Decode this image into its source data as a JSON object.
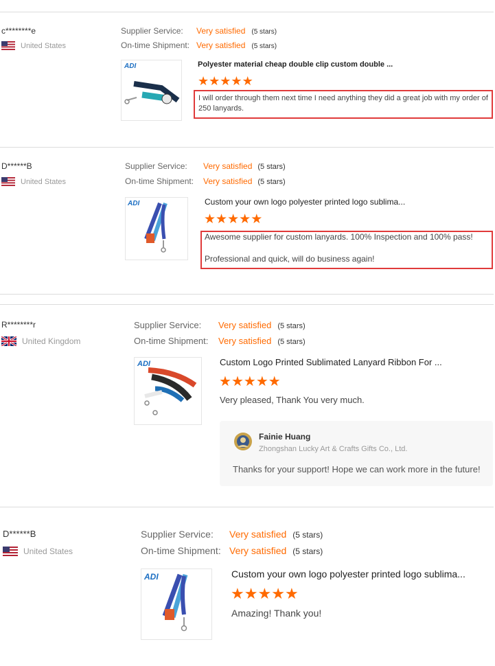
{
  "labels": {
    "supplier_service": "Supplier Service:",
    "on_time_shipment": "On-time Shipment:"
  },
  "colors": {
    "accent": "#ff6a00",
    "highlight_box": "#e03a3a"
  },
  "reviews": [
    {
      "buyer": "c********e",
      "country": "United States",
      "flag_icon": "us-flag-icon",
      "supplier_service": {
        "value": "Very satisfied",
        "stars": "(5 stars)"
      },
      "on_time_shipment": {
        "value": "Very satisfied",
        "stars": "(5 stars)"
      },
      "product_title": "Polyester material cheap double clip custom double ...",
      "thumb_logo": "ADI",
      "rating": 5,
      "comment": "I will order through them next time I need anything they did a great job with my order of 250 lanyards."
    },
    {
      "buyer": "D******B",
      "country": "United States",
      "flag_icon": "us-flag-icon",
      "supplier_service": {
        "value": "Very satisfied",
        "stars": "(5 stars)"
      },
      "on_time_shipment": {
        "value": "Very satisfied",
        "stars": "(5 stars)"
      },
      "product_title": "Custom your own logo polyester printed logo sublima...",
      "thumb_logo": "ADI",
      "rating": 5,
      "comment_line1": "Awesome supplier for custom lanyards. 100% Inspection and 100% pass!",
      "comment_line2": "Professional and quick, will do business again!"
    },
    {
      "buyer": "R********r",
      "country": "United Kingdom",
      "flag_icon": "uk-flag-icon",
      "supplier_service": {
        "value": "Very satisfied",
        "stars": "(5 stars)"
      },
      "on_time_shipment": {
        "value": "Very satisfied",
        "stars": "(5 stars)"
      },
      "product_title": "Custom Logo Printed Sublimated Lanyard Ribbon For ...",
      "thumb_logo": "ADI",
      "rating": 5,
      "comment": "Very pleased, Thank You very much.",
      "reply": {
        "name": "Fainie Huang",
        "company": "Zhongshan Lucky Art & Crafts Gifts Co., Ltd.",
        "text": "Thanks for your support! Hope we can work more in the future!"
      }
    },
    {
      "buyer": "D******B",
      "country": "United States",
      "flag_icon": "us-flag-icon",
      "supplier_service": {
        "value": "Very satisfied",
        "stars": "(5 stars)"
      },
      "on_time_shipment": {
        "value": "Very satisfied",
        "stars": "(5 stars)"
      },
      "product_title": "Custom your own logo polyester printed logo sublima...",
      "thumb_logo": "ADI",
      "rating": 5,
      "comment": "Amazing! Thank you!"
    }
  ]
}
